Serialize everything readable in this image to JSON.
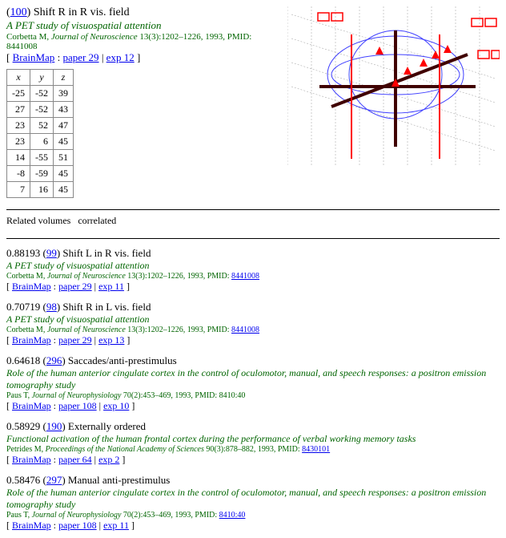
{
  "main": {
    "id_link": "100",
    "title_rest": ") Shift R in R vis. field",
    "study_desc": "A PET study of visuospatial attention",
    "citation_author": "Corbetta M, ",
    "citation_journal": "Journal of Neuroscience",
    "citation_rest": " 13(3):1202–1226, 1993, PMID: 8441008",
    "bm_open": "[ ",
    "bm_label": "BrainMap",
    "bm_sep": " : ",
    "bm_paper": "paper 29",
    "bm_mid": " | ",
    "bm_exp": "exp 12",
    "bm_close": " ]",
    "coords_headers": [
      "x",
      "y",
      "z"
    ],
    "coords": [
      [
        "-25",
        "-52",
        "39"
      ],
      [
        "27",
        "-52",
        "43"
      ],
      [
        "23",
        "52",
        "47"
      ],
      [
        "23",
        "6",
        "45"
      ],
      [
        "14",
        "-55",
        "51"
      ],
      [
        "-8",
        "-59",
        "45"
      ],
      [
        "7",
        "16",
        "45"
      ]
    ]
  },
  "section": {
    "label_a": "Related volumes",
    "label_b": "correlated"
  },
  "related": [
    {
      "score": "0.88193 (",
      "id": "99",
      "after_id": ") Shift L in R vis. field",
      "study_desc": "A PET study of visuospatial attention",
      "cit_author": "Corbetta M, ",
      "cit_journal": "Journal of Neuroscience",
      "cit_rest": " 13(3):1202–1226, 1993, PMID: ",
      "cit_pmid": "8441008",
      "bm_paper": "paper 29",
      "bm_exp": "exp 11"
    },
    {
      "score": "0.70719 (",
      "id": "98",
      "after_id": ") Shift R in L vis. field",
      "study_desc": "A PET study of visuospatial attention",
      "cit_author": "Corbetta M, ",
      "cit_journal": "Journal of Neuroscience",
      "cit_rest": " 13(3):1202–1226, 1993, PMID: ",
      "cit_pmid": "8441008",
      "bm_paper": "paper 29",
      "bm_exp": "exp 13"
    },
    {
      "score": "0.64618 (",
      "id": "296",
      "after_id": ") Saccades/anti-prestimulus",
      "study_desc": "Role of the human anterior cingulate cortex in the control of oculomotor, manual, and speech responses: a positron emission tomography study",
      "cit_author": "Paus T, ",
      "cit_journal": "Journal of Neurophysiology",
      "cit_rest": " 70(2):453–469, 1993, PMID: 8410:40",
      "cit_pmid": "",
      "bm_paper": "paper 108",
      "bm_exp": "exp 10"
    },
    {
      "score": "0.58929 (",
      "id": "190",
      "after_id": ") Externally ordered",
      "study_desc": "Functional activation of the human frontal cortex during the performance of verbal working memory tasks",
      "cit_author": "Petrides M, ",
      "cit_journal": "Proceedings of the National Academy of Sciences",
      "cit_rest": " 90(3):878–882, 1993, PMID: ",
      "cit_pmid": "8430101",
      "bm_paper": "paper 64",
      "bm_exp": "exp 2"
    },
    {
      "score": "0.58476 (",
      "id": "297",
      "after_id": ") Manual anti-prestimulus",
      "study_desc": "Role of the human anterior cingulate cortex in the control of oculomotor, manual, and speech responses: a positron emission tomography study",
      "cit_author": "Paus T, ",
      "cit_journal": "Journal of Neurophysiology",
      "cit_rest": " 70(2):453–469, 1993, PMID: ",
      "cit_pmid": "8410:40",
      "bm_paper": "paper 108",
      "bm_exp": "exp 11"
    }
  ]
}
